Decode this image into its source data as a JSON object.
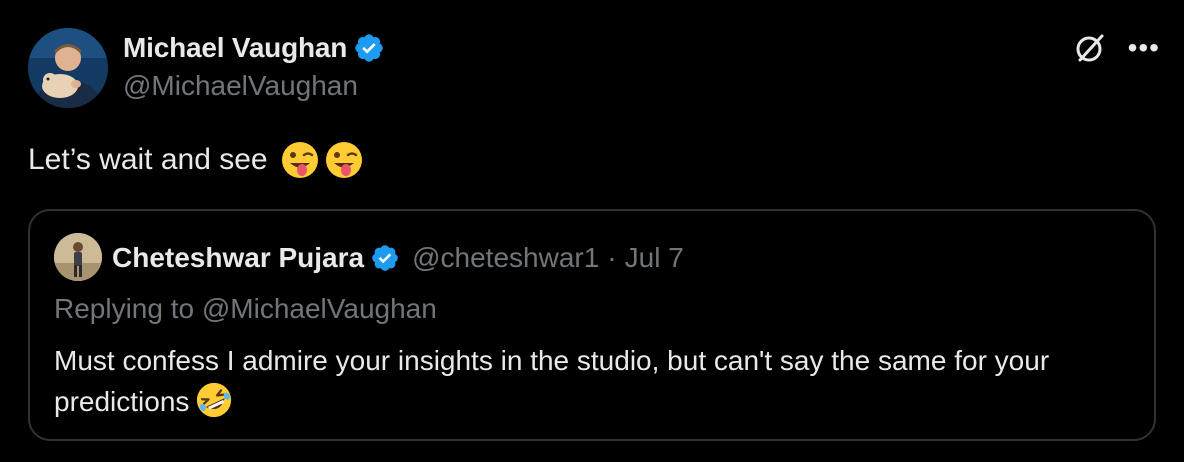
{
  "author": {
    "name": "Michael Vaughan",
    "handle": "@MichaelVaughan",
    "verified_icon": "verified-badge-icon"
  },
  "header_icons": {
    "grok": "grok-icon",
    "more": "•••"
  },
  "tweet": {
    "text": "Let’s wait and see",
    "emojis": [
      "winking-face-with-tongue",
      "winking-face-with-tongue"
    ]
  },
  "quote": {
    "name": "Cheteshwar Pujara",
    "handle": "@cheteshwar1",
    "separator": "·",
    "date": "Jul 7",
    "replying_to": "Replying to @MichaelVaughan",
    "text": "Must confess I admire your insights in the studio, but can't say the same for your predictions",
    "emoji": "rolling-on-the-floor-laughing"
  },
  "colors": {
    "background": "#000000",
    "primary_text": "#e7e9ea",
    "secondary_text": "#71767b",
    "border": "#2f3336",
    "verified_blue": "#1d9bf0"
  }
}
